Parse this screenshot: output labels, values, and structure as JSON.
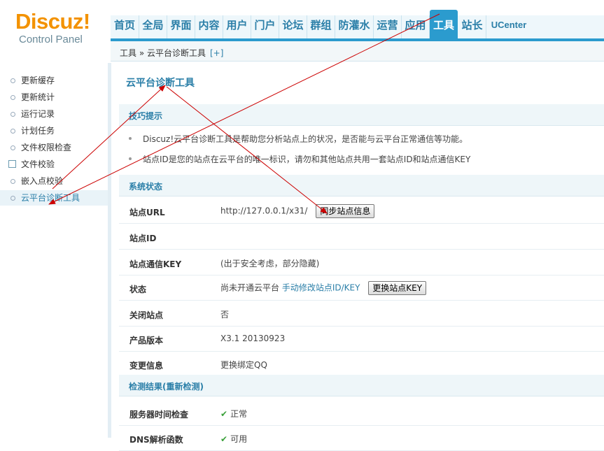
{
  "logo": {
    "main": "Discuz!",
    "sub": "Control Panel"
  },
  "nav": {
    "items": [
      {
        "label": "首页"
      },
      {
        "label": "全局"
      },
      {
        "label": "界面"
      },
      {
        "label": "内容"
      },
      {
        "label": "用户"
      },
      {
        "label": "门户"
      },
      {
        "label": "论坛"
      },
      {
        "label": "群组"
      },
      {
        "label": "防灌水"
      },
      {
        "label": "运营"
      },
      {
        "label": "应用"
      },
      {
        "label": "工具"
      },
      {
        "label": "站长"
      },
      {
        "label": "UCenter"
      }
    ],
    "active": "工具"
  },
  "breadcrumb": {
    "path": "工具 » 云平台诊断工具",
    "plus": "[+]"
  },
  "sidebar": {
    "items": [
      {
        "label": "更新缓存"
      },
      {
        "label": "更新统计"
      },
      {
        "label": "运行记录"
      },
      {
        "label": "计划任务"
      },
      {
        "label": "文件权限检查"
      },
      {
        "label": "文件校验"
      },
      {
        "label": "嵌入点校验"
      },
      {
        "label": "云平台诊断工具"
      }
    ]
  },
  "main": {
    "title": "云平台诊断工具",
    "tips_header": "技巧提示",
    "tips": [
      "Discuz!云平台诊断工具是帮助您分析站点上的状况，是否能与云平台正常通信等功能。",
      "站点ID是您的站点在云平台的唯一标识，请勿和其他站点共用一套站点ID和站点通信KEY"
    ],
    "status_header": "系统状态",
    "rows": {
      "site_url": {
        "label": "站点URL",
        "value": "http://127.0.0.1/x31/",
        "button": "同步站点信息"
      },
      "site_id": {
        "label": "站点ID",
        "value": ""
      },
      "site_key": {
        "label": "站点通信KEY",
        "value": "(出于安全考虑，部分隐藏)"
      },
      "state": {
        "label": "状态",
        "value": "尚未开通云平台",
        "link": "手动修改站点ID/KEY",
        "button": "更换站点KEY"
      },
      "close_site": {
        "label": "关闭站点",
        "value": "否"
      },
      "version": {
        "label": "产品版本",
        "value": "X3.1 20130923"
      },
      "change": {
        "label": "变更信息",
        "link": "更换绑定QQ"
      }
    },
    "check_header": "检测结果(重新检测)",
    "checks": {
      "time": {
        "label": "服务器时间检查",
        "value": "正常"
      },
      "dns": {
        "label": "DNS解析函数",
        "value": "可用"
      }
    }
  },
  "colors": {
    "accent": "#2b9bce",
    "logo": "#f39200",
    "arrow": "#cc0000"
  }
}
